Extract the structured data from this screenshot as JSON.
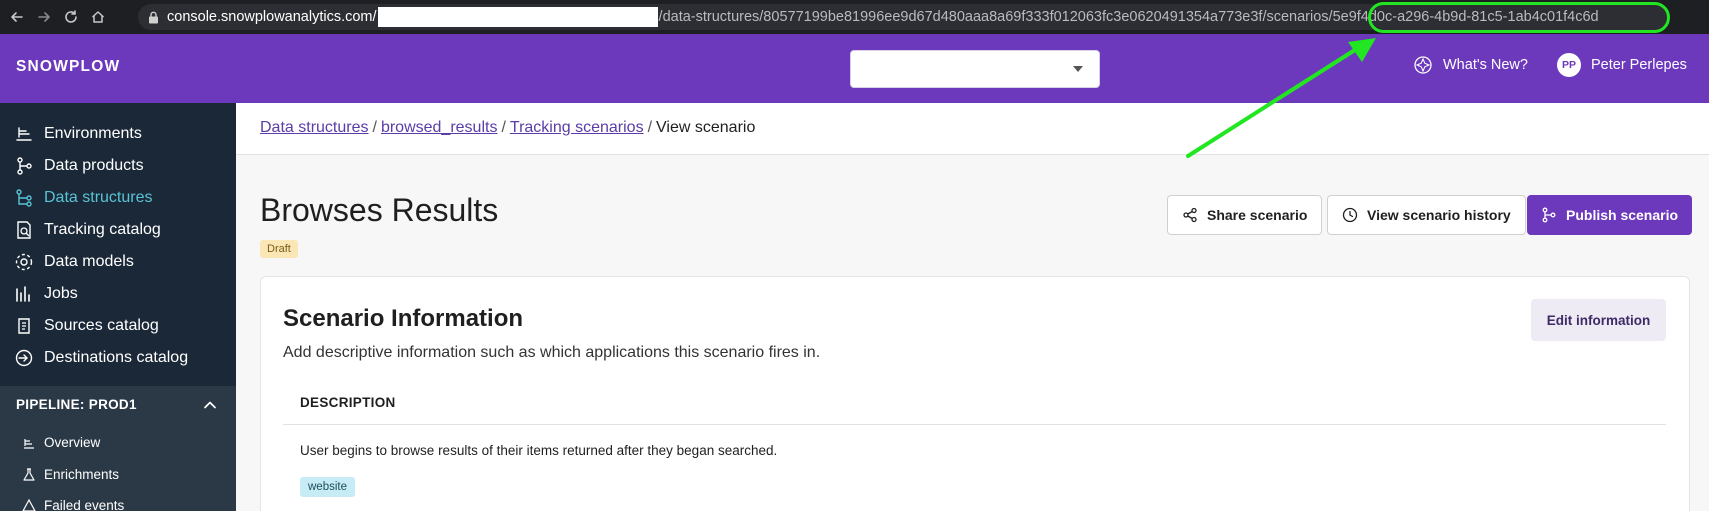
{
  "browser": {
    "url_host": "console.snowplowanalytics.com",
    "url_slash": "/",
    "url_path": "/data-structures/80577199be81996ee9d67d480aaa8a69f333f012063fc3e0620491354a773e3f/scenarios/",
    "url_highlight": "5e9f4d0c-a296-4b9d-81c5-1ab4c01f4c6d"
  },
  "header": {
    "logo": "SNOWPLOW",
    "whats_new": "What's New?",
    "avatar_initials": "PP",
    "user_name": "Peter Perlepes"
  },
  "sidebar": {
    "items": [
      {
        "label": "Environments",
        "icon": "environments-icon"
      },
      {
        "label": "Data products",
        "icon": "data-products-icon"
      },
      {
        "label": "Data structures",
        "icon": "data-structures-icon",
        "active": true
      },
      {
        "label": "Tracking catalog",
        "icon": "tracking-catalog-icon"
      },
      {
        "label": "Data models",
        "icon": "data-models-icon"
      },
      {
        "label": "Jobs",
        "icon": "jobs-icon"
      },
      {
        "label": "Sources catalog",
        "icon": "sources-catalog-icon"
      },
      {
        "label": "Destinations catalog",
        "icon": "destinations-catalog-icon"
      }
    ],
    "pipeline_title": "PIPELINE: PROD1",
    "pipeline_items": [
      {
        "label": "Overview",
        "icon": "overview-icon"
      },
      {
        "label": "Enrichments",
        "icon": "enrichments-icon"
      },
      {
        "label": "Failed events",
        "icon": "failed-events-icon"
      }
    ]
  },
  "breadcrumb": {
    "items": [
      "Data structures",
      "browsed_results",
      "Tracking scenarios"
    ],
    "current": "View scenario",
    "separator": "/"
  },
  "page": {
    "title": "Browses Results",
    "status_badge": "Draft",
    "share_button": "Share scenario",
    "history_button": "View scenario history",
    "publish_button": "Publish scenario"
  },
  "scenario_info": {
    "title": "Scenario Information",
    "subtitle": "Add descriptive information such as which applications this scenario fires in.",
    "edit_button": "Edit information",
    "description_label": "DESCRIPTION",
    "description": "User begins to browse results of their items returned after they began searched.",
    "tag": "website"
  },
  "colors": {
    "brand_purple": "#6c38bc",
    "sidebar_bg": "#1b2837",
    "active_teal": "#58c4d6",
    "annotation_green": "#22e622"
  }
}
